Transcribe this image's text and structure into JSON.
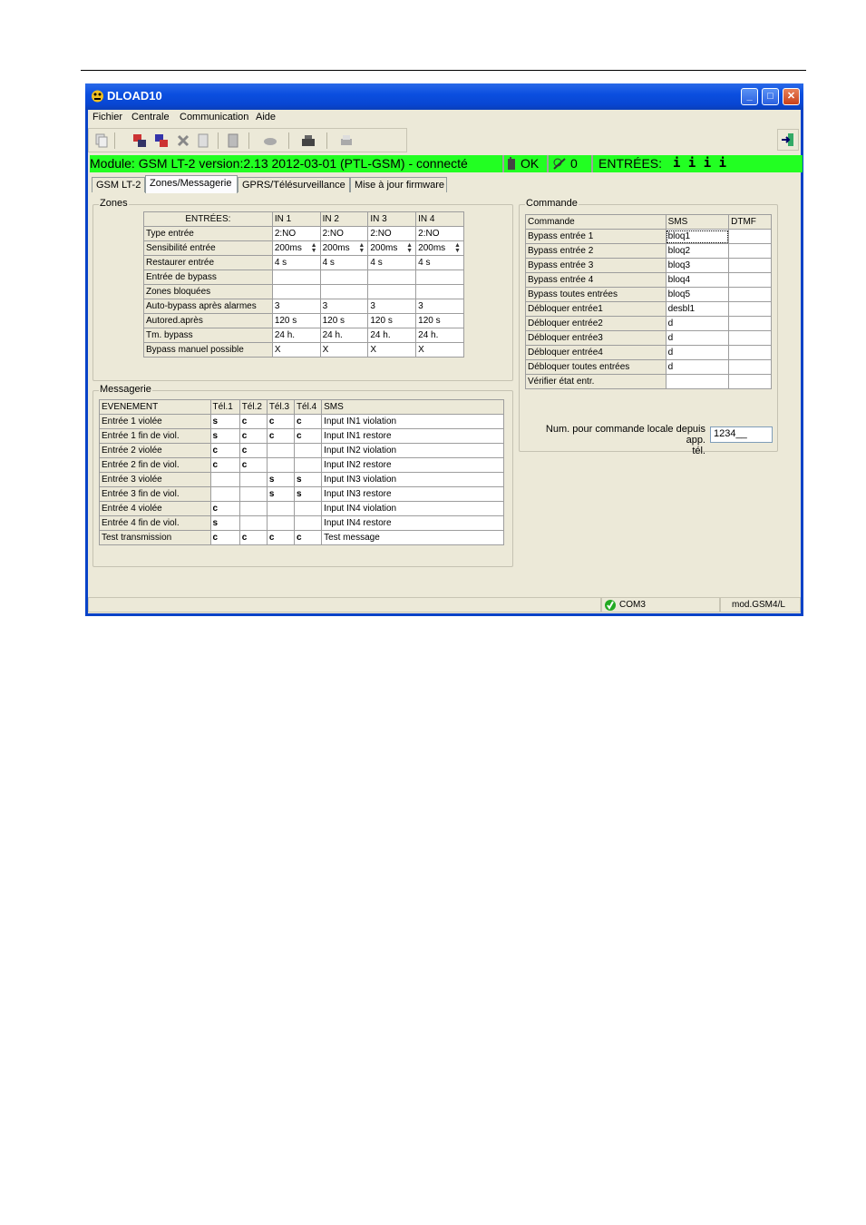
{
  "window": {
    "title": "DLOAD10"
  },
  "menu": [
    "Fichier",
    "Centrale",
    "Communication",
    "Aide"
  ],
  "status": {
    "module": "Module: GSM LT-2 version:2.13 2012-03-01 (PTL-GSM) - connecté",
    "ok": "OK",
    "signal": "0",
    "entrees_label": "ENTRÉES:",
    "entrees_value": "i i i i"
  },
  "tabs": [
    "GSM LT-2",
    "Zones/Messagerie",
    "GPRS/Télésurveillance",
    "Mise à jour firmware"
  ],
  "zones": {
    "label": "Zones",
    "columns": [
      "ENTRÉES:",
      "IN 1",
      "IN 2",
      "IN 3",
      "IN 4"
    ],
    "rows": [
      [
        "Type entrée",
        "2:NO",
        "2:NO",
        "2:NO",
        "2:NO"
      ],
      [
        "Sensibilité entrée",
        "200ms",
        "200ms",
        "200ms",
        "200ms"
      ],
      [
        "Restaurer entrée",
        "4 s",
        "4 s",
        "4 s",
        "4 s"
      ],
      [
        "Entrée de bypass",
        "",
        "",
        "",
        ""
      ],
      [
        "Zones bloquées",
        "",
        "",
        "",
        ""
      ],
      [
        "Auto-bypass après alarmes",
        "3",
        "3",
        "3",
        "3"
      ],
      [
        "Autored.après",
        "120 s",
        "120 s",
        "120 s",
        "120 s"
      ],
      [
        "Tm. bypass",
        "24 h.",
        "24 h.",
        "24 h.",
        "24 h."
      ],
      [
        "Bypass manuel possible",
        "X",
        "X",
        "X",
        "X"
      ]
    ]
  },
  "messagerie": {
    "label": "Messagerie",
    "columns": [
      "EVENEMENT",
      "Tél.1",
      "Tél.2",
      "Tél.3",
      "Tél.4",
      "SMS"
    ],
    "rows": [
      [
        "Entrée 1 violée",
        "s",
        "c",
        "c",
        "c",
        "Input IN1 violation"
      ],
      [
        "Entrée 1 fin de viol.",
        "s",
        "c",
        "c",
        "c",
        "Input IN1 restore"
      ],
      [
        "Entrée 2 violée",
        "c",
        "c",
        "",
        "",
        "Input IN2 violation"
      ],
      [
        "Entrée 2 fin de viol.",
        "c",
        "c",
        "",
        "",
        "Input IN2 restore"
      ],
      [
        "Entrée 3 violée",
        "",
        "",
        "s",
        "s",
        "Input IN3 violation"
      ],
      [
        "Entrée 3 fin de viol.",
        "",
        "",
        "s",
        "s",
        "Input IN3 restore"
      ],
      [
        "Entrée 4 violée",
        "c",
        "",
        "",
        "",
        "Input IN4 violation"
      ],
      [
        "Entrée 4 fin de viol.",
        "s",
        "",
        "",
        "",
        "Input IN4 restore"
      ],
      [
        "Test transmission",
        "c",
        "c",
        "c",
        "c",
        "Test message"
      ]
    ]
  },
  "commande": {
    "label": "Commande",
    "columns": [
      "Commande",
      "SMS",
      "DTMF"
    ],
    "rows": [
      [
        "Bypass entrée 1",
        "bloq1",
        ""
      ],
      [
        "Bypass entrée 2",
        "bloq2",
        ""
      ],
      [
        "Bypass entrée 3",
        "bloq3",
        ""
      ],
      [
        "Bypass entrée 4",
        "bloq4",
        ""
      ],
      [
        "Bypass toutes entrées",
        "bloq5",
        ""
      ],
      [
        "Débloquer entrée1",
        "desbl1",
        ""
      ],
      [
        "Débloquer entrée2",
        "d",
        ""
      ],
      [
        "Débloquer entrée3",
        "d",
        ""
      ],
      [
        "Débloquer entrée4",
        "d",
        ""
      ],
      [
        "Débloquer toutes entrées",
        "d",
        ""
      ],
      [
        "Vérifier état entr.",
        "",
        ""
      ]
    ],
    "local_label_1": "Num. pour commande locale depuis app.",
    "local_label_2": "tél.",
    "local_value": "1234__"
  },
  "bottom_status": {
    "port": "COM3",
    "module": "mod.GSM4/L"
  }
}
